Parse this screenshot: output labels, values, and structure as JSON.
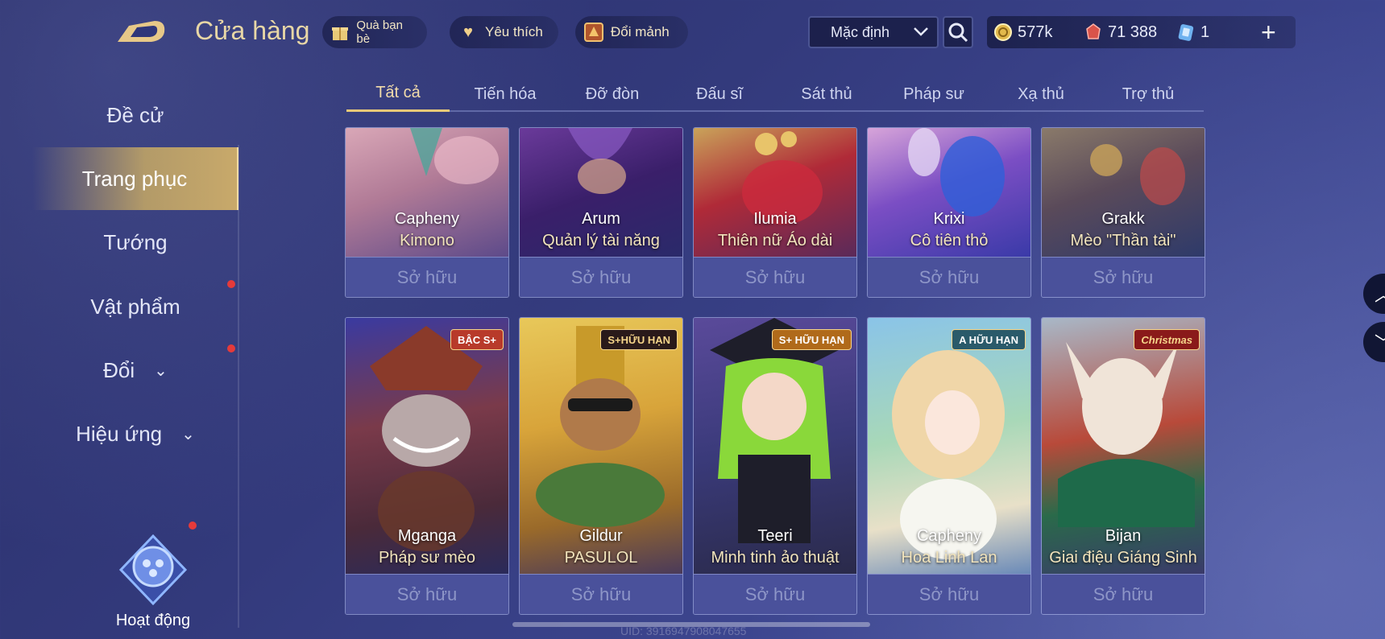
{
  "header": {
    "title": "Cửa hàng",
    "gift_label": "Quà bạn bè",
    "favorite_label": "Yêu thích",
    "exchange_label": "Đổi mảnh",
    "sort_value": "Mặc định"
  },
  "currencies": {
    "gold": "577k",
    "gems": "71 388",
    "vouchers": "1"
  },
  "sidebar": {
    "items": [
      {
        "label": "Đề cử"
      },
      {
        "label": "Trang phục"
      },
      {
        "label": "Tướng"
      },
      {
        "label": "Vật phẩm"
      },
      {
        "label": "Đổi"
      },
      {
        "label": "Hiệu ứng"
      }
    ],
    "activity_label": "Hoạt động"
  },
  "tabs": [
    "Tất cả",
    "Tiến hóa",
    "Đỡ đòn",
    "Đấu sĩ",
    "Sát thủ",
    "Pháp sư",
    "Xạ thủ",
    "Trợ thủ"
  ],
  "cards_row1": [
    {
      "hero": "Capheny",
      "skin": "Kimono",
      "status": "Sở hữu"
    },
    {
      "hero": "Arum",
      "skin": "Quản lý tài năng",
      "status": "Sở hữu"
    },
    {
      "hero": "Ilumia",
      "skin": "Thiên nữ Áo dài",
      "status": "Sở hữu"
    },
    {
      "hero": "Krixi",
      "skin": "Cô tiên thỏ",
      "status": "Sở hữu"
    },
    {
      "hero": "Grakk",
      "skin": "Mèo \"Thần tài\"",
      "status": "Sở hữu"
    }
  ],
  "cards_row2": [
    {
      "hero": "Mganga",
      "skin": "Pháp sư mèo",
      "status": "Sở hữu",
      "badge": "BẬC S+"
    },
    {
      "hero": "Gildur",
      "skin": "PASULOL",
      "status": "Sở hữu",
      "badge": "S+HỮU HẠN"
    },
    {
      "hero": "Teeri",
      "skin": "Minh tinh ảo thuật",
      "status": "Sở hữu",
      "badge": "S+ HỮU HẠN"
    },
    {
      "hero": "Capheny",
      "skin": "Hoa Linh Lan",
      "status": "Sở hữu",
      "badge": "A HỮU HẠN"
    },
    {
      "hero": "Bijan",
      "skin": "Giai điệu Giáng Sinh",
      "status": "Sở hữu",
      "badge": "Christmas"
    }
  ],
  "footer": {
    "uid": "UID: 3916947908047655"
  },
  "icons": {
    "back": "back-arrow-icon",
    "gift": "gift-icon",
    "heart": "heart-icon",
    "exchange": "fragment-icon",
    "search": "search-icon",
    "gold": "gold-coin-icon",
    "gem": "gem-icon",
    "voucher": "voucher-icon"
  },
  "colors": {
    "accent_gold": "#e8c978",
    "bg": "#333a7c",
    "owned_button": "#4a519b"
  }
}
